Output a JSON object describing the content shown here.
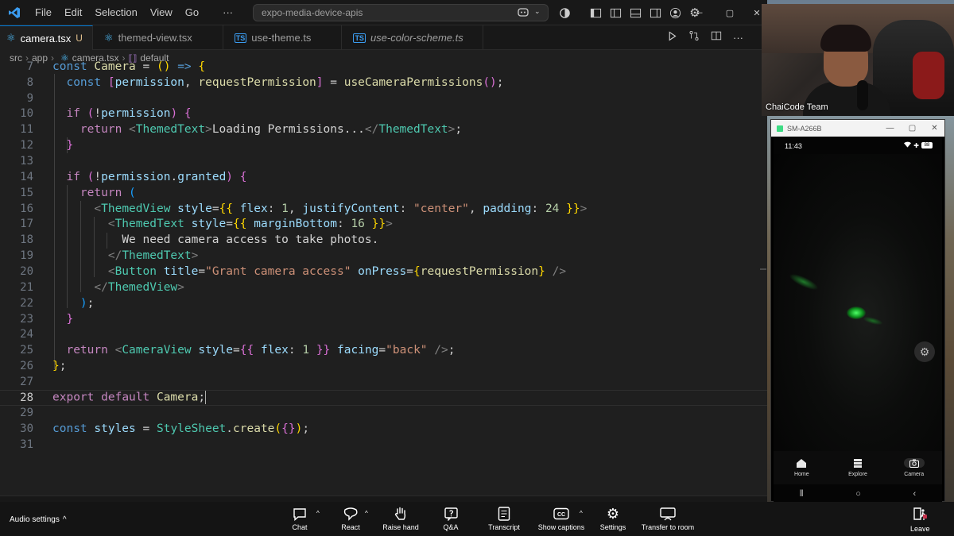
{
  "window": {
    "menu": [
      "File",
      "Edit",
      "Selection",
      "View",
      "Go",
      "···"
    ],
    "search_text": "expo-media-device-apis"
  },
  "tabs": [
    {
      "label": "camera.tsx",
      "icon": "react-icon",
      "modified": "U",
      "active": true,
      "italic": false
    },
    {
      "label": "themed-view.tsx",
      "icon": "react-icon",
      "modified": "",
      "active": false,
      "italic": false
    },
    {
      "label": "use-theme.ts",
      "icon": "typescript-icon",
      "modified": "",
      "active": false,
      "italic": false
    },
    {
      "label": "use-color-scheme.ts",
      "icon": "typescript-icon",
      "modified": "",
      "active": false,
      "italic": true
    }
  ],
  "breadcrumb": [
    "src",
    "app",
    "camera.tsx",
    "default"
  ],
  "editor": {
    "current_line": "28",
    "line_numbers": [
      "7",
      "8",
      "9",
      "10",
      "11",
      "12",
      "13",
      "14",
      "15",
      "16",
      "17",
      "18",
      "19",
      "20",
      "21",
      "22",
      "23",
      "24",
      "25",
      "26",
      "27",
      "28",
      "29",
      "30",
      "31"
    ]
  },
  "webcam": {
    "participant_name": "ChaiCode Team"
  },
  "emulator": {
    "title": "SM-A266B",
    "time": "11:43",
    "battery": "88",
    "tabs": [
      {
        "label": "Home",
        "icon": "home-icon"
      },
      {
        "label": "Explore",
        "icon": "explore-icon"
      },
      {
        "label": "Camera",
        "icon": "camera-icon"
      }
    ]
  },
  "meeting_bar": {
    "audio_settings": "Audio settings",
    "buttons": [
      {
        "label": "Chat",
        "icon": "chat-icon"
      },
      {
        "label": "React",
        "icon": "react-heart-icon"
      },
      {
        "label": "Raise hand",
        "icon": "hand-icon"
      },
      {
        "label": "Q&A",
        "icon": "qa-icon"
      },
      {
        "label": "Transcript",
        "icon": "transcript-icon"
      },
      {
        "label": "Show captions",
        "icon": "captions-icon"
      },
      {
        "label": "Settings",
        "icon": "gear-icon"
      },
      {
        "label": "Transfer to room",
        "icon": "transfer-icon"
      }
    ],
    "leave": "Leave"
  },
  "colors": {
    "editor_bg": "#1f1f1f",
    "keyword": "#569cd6",
    "function": "#dcdcaa",
    "string": "#ce9178",
    "component": "#4ec9b0"
  }
}
